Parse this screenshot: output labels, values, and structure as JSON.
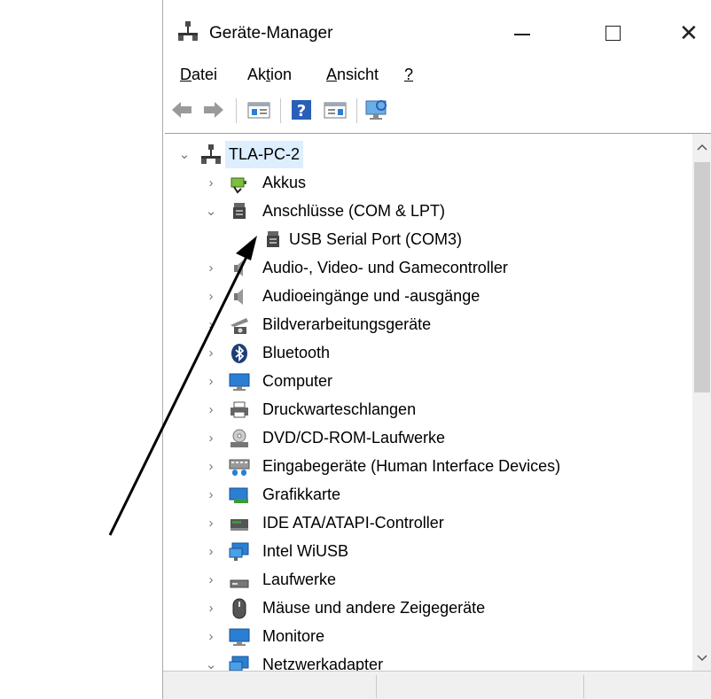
{
  "window": {
    "title": "Geräte-Manager",
    "close_glyph": "✕"
  },
  "menu": {
    "datei": {
      "mnemonic": "D",
      "rest": "atei"
    },
    "aktion": {
      "pre": "Ak",
      "mnemonic": "t",
      "rest": "ion"
    },
    "ansicht": {
      "mnemonic": "A",
      "rest": "nsicht"
    },
    "help": {
      "mnemonic": "?"
    }
  },
  "toolbar": {
    "buttons": [
      "back-icon",
      "forward-icon",
      "properties-panel-icon",
      "help-icon",
      "action-panel-icon",
      "monitor-scan-icon"
    ]
  },
  "tree": {
    "root": {
      "label": "TLA-PC-2",
      "expanded": true
    },
    "items": [
      {
        "label": "Akkus",
        "expanded": false,
        "icon": "battery-icon"
      },
      {
        "label": "Anschlüsse (COM & LPT)",
        "expanded": true,
        "icon": "port-icon"
      },
      {
        "label": "USB Serial Port (COM3)",
        "child": true,
        "icon": "port-icon"
      },
      {
        "label": "Audio-, Video- und Gamecontroller",
        "expanded": false,
        "icon": "speaker-icon"
      },
      {
        "label": "Audioeingänge und -ausgänge",
        "expanded": false,
        "icon": "speaker-icon"
      },
      {
        "label": "Bildverarbeitungsgeräte",
        "expanded": false,
        "icon": "camera-icon"
      },
      {
        "label": "Bluetooth",
        "expanded": false,
        "icon": "bluetooth-icon"
      },
      {
        "label": "Computer",
        "expanded": false,
        "icon": "computer-icon"
      },
      {
        "label": "Druckwarteschlangen",
        "expanded": false,
        "icon": "printer-icon"
      },
      {
        "label": "DVD/CD-ROM-Laufwerke",
        "expanded": false,
        "icon": "disc-drive-icon"
      },
      {
        "label": "Eingabegeräte (Human Interface Devices)",
        "expanded": false,
        "icon": "hid-icon"
      },
      {
        "label": "Grafikkarte",
        "expanded": false,
        "icon": "graphics-card-icon"
      },
      {
        "label": "IDE ATA/ATAPI-Controller",
        "expanded": false,
        "icon": "ide-controller-icon"
      },
      {
        "label": "Intel WiUSB",
        "expanded": false,
        "icon": "network-icon"
      },
      {
        "label": "Laufwerke",
        "expanded": false,
        "icon": "drive-icon"
      },
      {
        "label": "Mäuse und andere Zeigegeräte",
        "expanded": false,
        "icon": "mouse-icon"
      },
      {
        "label": "Monitore",
        "expanded": false,
        "icon": "monitor-icon"
      },
      {
        "label": "Netzwerkadapter",
        "expanded": true,
        "icon": "network-icon"
      }
    ]
  },
  "colors": {
    "root_highlight": "#ddeeff",
    "monitor_blue": "#2a7fd4"
  }
}
